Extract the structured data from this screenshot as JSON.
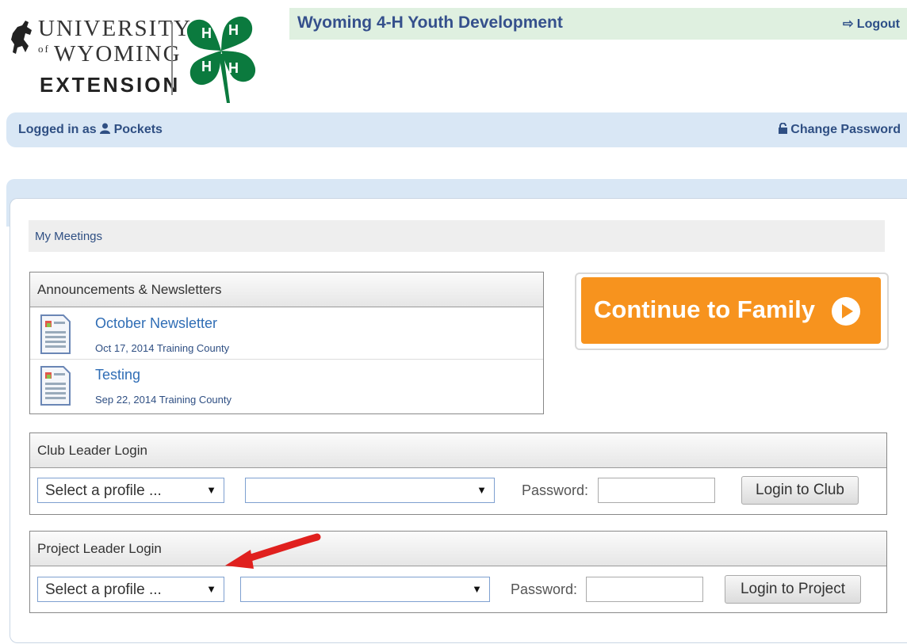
{
  "header": {
    "logo": {
      "line1": "UNIVERSITY",
      "line2_prefix": "of",
      "line2": "WYOMING",
      "line3": "EXTENSION"
    },
    "app_title": "Wyoming 4-H Youth Development",
    "logout_label": "Logout"
  },
  "user_bar": {
    "logged_in_prefix": "Logged in as",
    "username": "Pockets",
    "change_password_label": "Change Password"
  },
  "nav": {
    "my_meetings": "My Meetings"
  },
  "announcements": {
    "title": "Announcements & Newsletters",
    "items": [
      {
        "title": "October Newsletter",
        "meta": "Oct 17, 2014 Training County"
      },
      {
        "title": "Testing",
        "meta": "Sep 22, 2014 Training County"
      }
    ]
  },
  "continue_button": {
    "label": "Continue to Family"
  },
  "club_login": {
    "title": "Club Leader Login",
    "profile_select": "Select a profile ...",
    "second_select": "",
    "password_label": "Password:",
    "button_label": "Login to Club"
  },
  "project_login": {
    "title": "Project Leader Login",
    "profile_select": "Select a profile ...",
    "second_select": "",
    "password_label": "Password:",
    "button_label": "Login to Project"
  },
  "colors": {
    "accent_orange": "#f7931e",
    "title_blue": "#35508c",
    "clover_green": "#0b7a3e"
  }
}
